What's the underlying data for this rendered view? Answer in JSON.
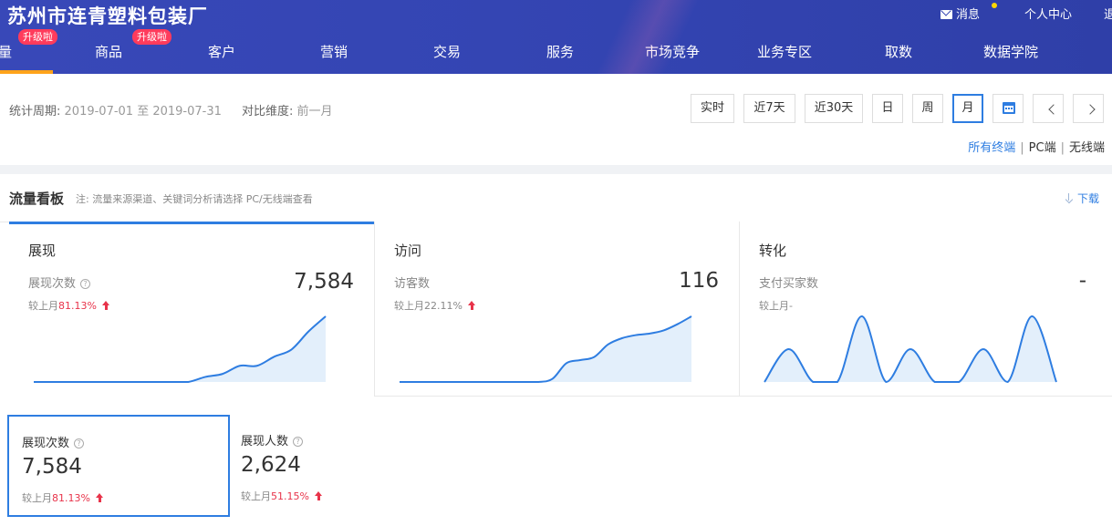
{
  "header": {
    "shop_name": "苏州市连青塑料包装厂",
    "messages_label": "消息",
    "user_center_label": "个人中心",
    "truncated_link_label": "退",
    "upgrade_badge_label": "升级啦",
    "active_nav_fragment": "量",
    "nav": [
      "商品",
      "客户",
      "营销",
      "交易",
      "服务",
      "市场竞争",
      "业务专区",
      "取数",
      "数据学院"
    ]
  },
  "filter": {
    "period_label": "统计周期:",
    "period_value": "2019-07-01 至 2019-07-31",
    "compare_label": "对比维度:",
    "compare_value": "前一月",
    "time_buttons": [
      "实时",
      "近7天",
      "近30天",
      "日",
      "周",
      "月"
    ],
    "active_time_button": "月",
    "terminals": [
      "所有终端",
      "PC端",
      "无线端"
    ],
    "active_terminal": "所有终端"
  },
  "board": {
    "title": "流量看板",
    "note": "注: 流量来源渠道、关键词分析请选择 PC/无线端查看",
    "download_label": "下载"
  },
  "cards": [
    {
      "title": "展现",
      "metric_label": "展现次数",
      "value": "7,584",
      "compare_prefix": "较上月",
      "compare_value": "81.13%",
      "trend": "up",
      "spark_color": "#2e7de1",
      "spark": [
        0,
        0,
        0,
        0,
        0,
        0,
        0,
        0,
        0,
        0,
        0.5,
        0.8,
        1.6,
        1.6,
        2.5,
        3.2,
        5.0,
        6.5
      ]
    },
    {
      "title": "访问",
      "metric_label": "访客数",
      "value": "116",
      "compare_prefix": "较上月",
      "compare_value": "22.11%",
      "trend": "up",
      "spark_color": "#2e7de1",
      "spark": [
        0,
        0,
        0,
        0,
        0,
        0,
        0,
        0,
        0,
        0,
        0,
        0.2,
        1.2,
        1.4,
        1.6,
        2.4,
        2.8,
        3.0,
        3.1,
        3.3,
        3.7,
        4.2
      ]
    },
    {
      "title": "转化",
      "metric_label": "支付买家数",
      "value": "-",
      "compare_prefix": "较上月",
      "compare_value": "-",
      "trend": "none",
      "spark_color": "#2e7de1",
      "spark": [
        0,
        1,
        0,
        0,
        2,
        0,
        1,
        0,
        0,
        1,
        0,
        2,
        0
      ]
    }
  ],
  "metrics": [
    {
      "label": "展现次数",
      "value": "7,584",
      "compare_prefix": "较上月",
      "compare_value": "81.13%",
      "selected": true
    },
    {
      "label": "展现人数",
      "value": "2,624",
      "compare_prefix": "较上月",
      "compare_value": "51.15%",
      "selected": false
    }
  ],
  "icons": {
    "help": "?",
    "mail": "mail-icon",
    "calendar": "calendar-icon",
    "prev": "chevron-left-icon",
    "next": "chevron-right-icon",
    "download": "download-icon",
    "trend_up": "arrow-up-icon"
  }
}
